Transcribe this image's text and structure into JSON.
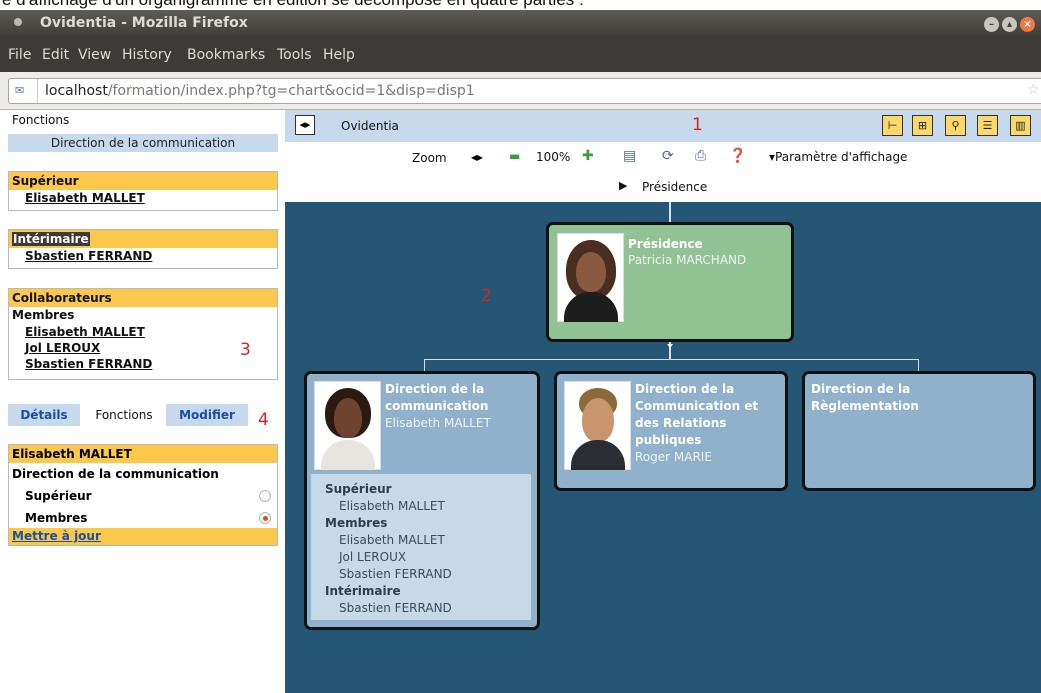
{
  "caption": "e d'affichage d'un organigramme en édition se décompose en quatre parties :",
  "window": {
    "title": "Ovidentia - Mozilla Firefox"
  },
  "menu": {
    "file": "File",
    "edit": "Edit",
    "view": "View",
    "history": "History",
    "bookmarks": "Bookmarks",
    "tools": "Tools",
    "help": "Help"
  },
  "url": {
    "host": "localhost",
    "path": "/formation/index.php?tg=chart&ocid=1&disp=disp1"
  },
  "sidebar": {
    "title": "Fonctions",
    "current_function": "Direction de la communication",
    "superior": {
      "header": "Supérieur",
      "name": "Elisabeth MALLET"
    },
    "interim": {
      "header": "Intérimaire",
      "name": "Sbastien FERRAND"
    },
    "collaborators": {
      "header": "Collaborateurs",
      "members_label": "Membres",
      "members": [
        "Elisabeth MALLET",
        "Jol LEROUX",
        "Sbastien FERRAND"
      ]
    },
    "tabs": {
      "details": "Détails",
      "functions": "Fonctions",
      "modify": "Modifier"
    },
    "edit": {
      "header": "Elisabeth MALLET",
      "function": "Direction de la communication",
      "role_superior": "Supérieur",
      "role_members": "Membres",
      "selected_role": "Membres",
      "update_link": "Mettre à jour"
    },
    "callouts": {
      "three": "3",
      "four": "4"
    }
  },
  "main": {
    "title": "Ovidentia",
    "callouts": {
      "one": "1",
      "two": "2"
    },
    "zoom_label": "Zoom",
    "zoom_level": "100%",
    "display_params": "Paramètre d'affichage",
    "breadcrumb": "Présidence"
  },
  "colors": {
    "accent": "#fbc84b",
    "sidebar_blue": "#c7d9ec",
    "canvas": "#255675",
    "top_node": "#91c293",
    "sub_node": "#8fb1cb",
    "callout": "#d8241f"
  },
  "chart": {
    "top": {
      "title": "Présidence",
      "person": "Patricia MARCHAND"
    },
    "children": [
      {
        "title_lines": [
          "Direction de la",
          "communication"
        ],
        "person": "Elisabeth MALLET"
      },
      {
        "title_lines": [
          "Direction de la",
          "Communication et",
          "des Relations",
          "publiques"
        ],
        "person": "Roger MARIE"
      },
      {
        "title_lines": [
          "Direction de la",
          "Règlementation"
        ],
        "person": ""
      }
    ],
    "details": {
      "superior_label": "Supérieur",
      "superior": "Elisabeth MALLET",
      "members_label": "Membres",
      "members": [
        "Elisabeth MALLET",
        "Jol LEROUX",
        "Sbastien FERRAND"
      ],
      "interim_label": "Intérimaire",
      "interim": "Sbastien FERRAND"
    }
  }
}
